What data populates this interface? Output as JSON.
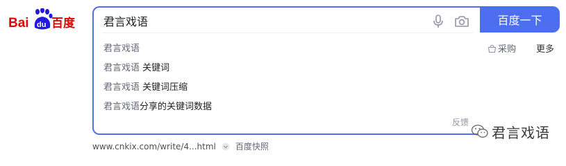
{
  "logo": {
    "text_left": "Bai",
    "paw_text": "du",
    "text_right": "百度"
  },
  "search": {
    "query": "君言戏语",
    "button_label": "百度一下"
  },
  "suggestions": [
    {
      "query": "君言戏语",
      "suffix": ""
    },
    {
      "query": "君言戏语",
      "suffix": " 关键词"
    },
    {
      "query": "君言戏语",
      "suffix": " 关键词压缩"
    },
    {
      "query": "君言戏语",
      "suffix": "分享的关键词数据"
    }
  ],
  "feedback_label": "反馈",
  "side_links": {
    "purchase": "采购",
    "more": "更多"
  },
  "result": {
    "url": "www.cnkix.com/write/4...html",
    "snapshot": "百度快照"
  },
  "watermark": {
    "text": "君言戏语"
  },
  "colors": {
    "brand_blue": "#4e6ef2",
    "logo_red": "#e10602",
    "logo_blue": "#2319dc"
  }
}
